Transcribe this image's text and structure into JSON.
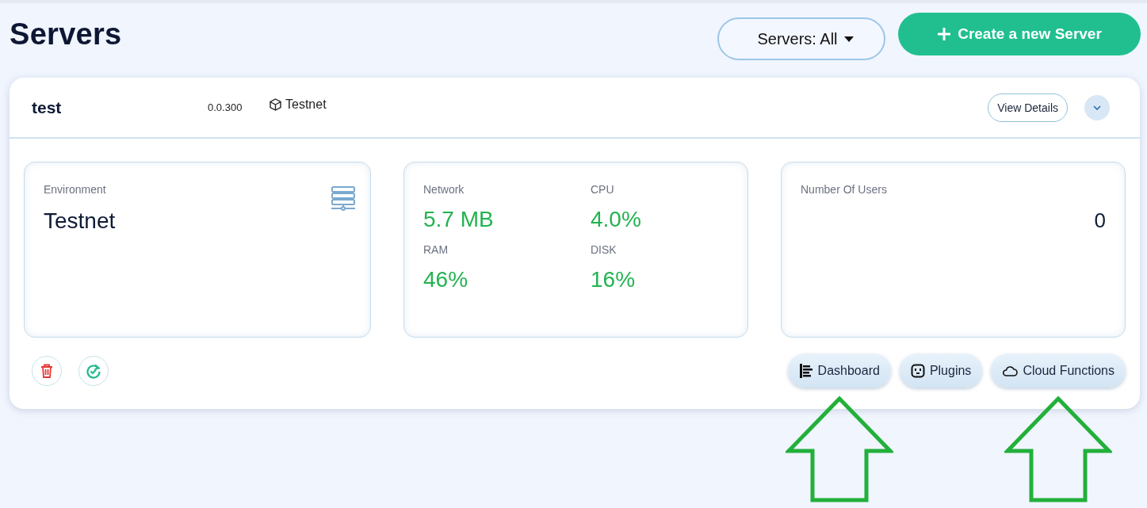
{
  "page": {
    "title": "Servers"
  },
  "filter": {
    "label": "Servers: All"
  },
  "create_button": {
    "label": "Create a new Server"
  },
  "server": {
    "name": "test",
    "version": "0.0.300",
    "network": "Testnet",
    "view_details": "View Details",
    "environment": {
      "label": "Environment",
      "value": "Testnet"
    },
    "metrics": [
      {
        "label": "Network",
        "value": "5.7 MB"
      },
      {
        "label": "CPU",
        "value": "4.0%"
      },
      {
        "label": "RAM",
        "value": "46%"
      },
      {
        "label": "DISK",
        "value": "16%"
      }
    ],
    "users": {
      "label": "Number Of Users",
      "value": "0"
    },
    "actions": [
      {
        "kind": "dashboard",
        "label": "Dashboard",
        "highlighted": true
      },
      {
        "kind": "plugins",
        "label": "Plugins",
        "highlighted": false
      },
      {
        "kind": "cloud",
        "label": "Cloud Functions",
        "highlighted": true
      }
    ]
  }
}
